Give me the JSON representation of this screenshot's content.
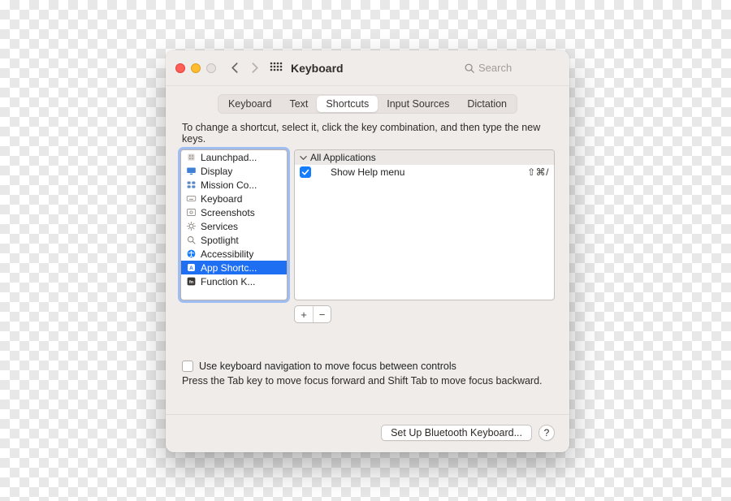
{
  "window": {
    "title": "Keyboard"
  },
  "search": {
    "placeholder": "Search"
  },
  "tabs": {
    "items": [
      "Keyboard",
      "Text",
      "Shortcuts",
      "Input Sources",
      "Dictation"
    ],
    "selected": "Shortcuts"
  },
  "instruction": "To change a shortcut, select it, click the key combination, and then type the new keys.",
  "categories": {
    "items": [
      {
        "label": "Launchpad...",
        "icon": "rocket"
      },
      {
        "label": "Display",
        "icon": "monitor"
      },
      {
        "label": "Mission Co...",
        "icon": "mission"
      },
      {
        "label": "Keyboard",
        "icon": "keyboard"
      },
      {
        "label": "Screenshots",
        "icon": "screenshot"
      },
      {
        "label": "Services",
        "icon": "gear"
      },
      {
        "label": "Spotlight",
        "icon": "search"
      },
      {
        "label": "Accessibility",
        "icon": "accessibility"
      },
      {
        "label": "App Shortc...",
        "icon": "appshortcut",
        "selected": true
      },
      {
        "label": "Function K...",
        "icon": "fn"
      }
    ]
  },
  "group": {
    "label": "All Applications"
  },
  "shortcuts": {
    "items": [
      {
        "label": "Show Help menu",
        "keys": "⇧⌘/",
        "checked": true
      }
    ]
  },
  "addremove": {
    "add": "+",
    "remove": "−"
  },
  "nav_checkbox": {
    "label": "Use keyboard navigation to move focus between controls"
  },
  "nav_hint": "Press the Tab key to move focus forward and Shift Tab to move focus backward.",
  "footer": {
    "bluetooth": "Set Up Bluetooth Keyboard...",
    "help": "?"
  }
}
